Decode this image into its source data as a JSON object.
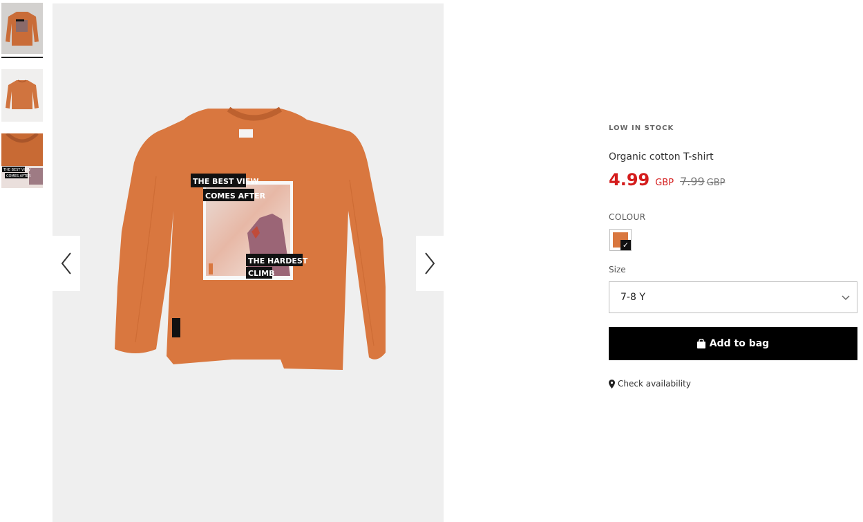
{
  "gallery": {
    "thumbnails": [
      {
        "alt": "thumbnail-front"
      },
      {
        "alt": "thumbnail-back"
      },
      {
        "alt": "thumbnail-detail"
      }
    ],
    "print_texts": [
      "THE BEST VIEW",
      "COMES AFTER",
      "THE HARDEST",
      "CLIMB"
    ],
    "detail_print_texts": [
      "THE BEST VIEW",
      "COMES AFTER"
    ],
    "garment_color": "#d9773f"
  },
  "product": {
    "stock_status": "LOW IN STOCK",
    "name": "Organic cotton T-shirt",
    "price_new": "4.99",
    "currency_new": "GBP",
    "price_old": "7.99",
    "currency_old": "GBP",
    "colour_label": "COLOUR",
    "colour_swatch": "#d9773f",
    "size_label": "Size",
    "size_value": "7-8 Y",
    "add_to_bag_label": "Add to bag",
    "check_availability_label": "Check availability"
  },
  "colors": {
    "sale_red": "#d41c1c",
    "button_black": "#000000",
    "gallery_bg": "#efefef"
  },
  "icons": {
    "prev": "chevron-left-icon",
    "next": "chevron-right-icon",
    "dropdown": "chevron-down-icon",
    "bag": "shopping-bag-icon",
    "location": "location-pin-icon",
    "check": "checkmark-icon"
  }
}
